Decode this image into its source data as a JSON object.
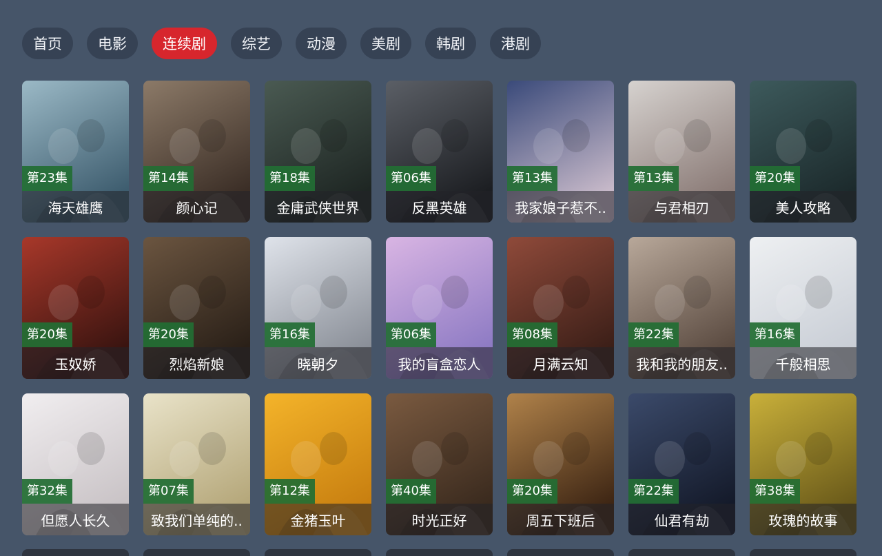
{
  "nav_tabs": [
    {
      "label": "首页"
    },
    {
      "label": "电影"
    },
    {
      "label": "连续剧"
    },
    {
      "label": "综艺"
    },
    {
      "label": "动漫"
    },
    {
      "label": "美剧"
    },
    {
      "label": "韩剧"
    },
    {
      "label": "港剧"
    }
  ],
  "active_tab": "连续剧",
  "colors": {
    "background": "#465569",
    "tab_bg": "#364254",
    "tab_active": "#d7262d",
    "episode_badge": "#226e34"
  },
  "shows": [
    {
      "title": "海天雄鹰",
      "episode": "第23集",
      "palette": [
        "#9bb9c6",
        "#3e5d6f"
      ],
      "icon": "poster-image"
    },
    {
      "title": "颜心记",
      "episode": "第14集",
      "palette": [
        "#8c7a68",
        "#3b2e26"
      ],
      "icon": "poster-image"
    },
    {
      "title": "金庸武侠世界",
      "episode": "第18集",
      "palette": [
        "#4a5a52",
        "#1e2623"
      ],
      "icon": "poster-image"
    },
    {
      "title": "反黑英雄",
      "episode": "第06集",
      "palette": [
        "#5b5f66",
        "#1c1e22"
      ],
      "icon": "poster-image"
    },
    {
      "title": "我家娘子惹不..",
      "episode": "第13集",
      "palette": [
        "#3a4a7a",
        "#c7b9c9"
      ],
      "icon": "poster-image"
    },
    {
      "title": "与君相刃",
      "episode": "第13集",
      "palette": [
        "#d6d2cf",
        "#8a7a76"
      ],
      "icon": "poster-image"
    },
    {
      "title": "美人攻略",
      "episode": "第20集",
      "palette": [
        "#3d5a5c",
        "#1c2a2c"
      ],
      "icon": "poster-image"
    },
    {
      "title": "玉奴娇",
      "episode": "第20集",
      "palette": [
        "#a8382a",
        "#3a1410"
      ],
      "icon": "poster-image"
    },
    {
      "title": "烈焰新娘",
      "episode": "第20集",
      "palette": [
        "#6b5540",
        "#2a2018"
      ],
      "icon": "poster-image"
    },
    {
      "title": "晓朝夕",
      "episode": "第16集",
      "palette": [
        "#dfe3ea",
        "#8a8f98"
      ],
      "icon": "poster-image"
    },
    {
      "title": "我的盲盒恋人",
      "episode": "第06集",
      "palette": [
        "#d9b5e3",
        "#8e7bc4"
      ],
      "icon": "poster-image"
    },
    {
      "title": "月满云知",
      "episode": "第08集",
      "palette": [
        "#8f4a3a",
        "#3c1f18"
      ],
      "icon": "poster-image"
    },
    {
      "title": "我和我的朋友..",
      "episode": "第22集",
      "palette": [
        "#b8a89a",
        "#5a4a40"
      ],
      "icon": "poster-image"
    },
    {
      "title": "千般相思",
      "episode": "第16集",
      "palette": [
        "#eef0f2",
        "#c9ced6"
      ],
      "icon": "poster-image"
    },
    {
      "title": "但愿人长久",
      "episode": "第32集",
      "palette": [
        "#f1eef0",
        "#c9c3c6"
      ],
      "icon": "poster-image"
    },
    {
      "title": "致我们单纯的..",
      "episode": "第07集",
      "palette": [
        "#e9e3c9",
        "#b5a77a"
      ],
      "icon": "poster-image"
    },
    {
      "title": "金猪玉叶",
      "episode": "第12集",
      "palette": [
        "#f4b42a",
        "#c87f10"
      ],
      "icon": "poster-image"
    },
    {
      "title": "时光正好",
      "episode": "第40集",
      "palette": [
        "#7a5a40",
        "#3a2a1e"
      ],
      "icon": "poster-image"
    },
    {
      "title": "周五下班后",
      "episode": "第20集",
      "palette": [
        "#b0824a",
        "#3e2614"
      ],
      "icon": "poster-image"
    },
    {
      "title": "仙君有劫",
      "episode": "第22集",
      "palette": [
        "#3b4a6a",
        "#141a2a"
      ],
      "icon": "poster-image"
    },
    {
      "title": "玫瑰的故事",
      "episode": "第38集",
      "palette": [
        "#c9b03a",
        "#6a5a1a"
      ],
      "icon": "poster-image"
    }
  ]
}
